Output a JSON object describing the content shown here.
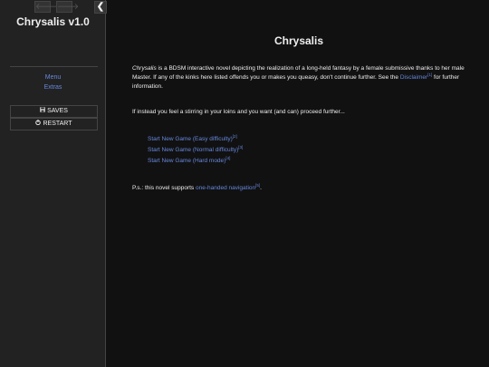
{
  "ui_bar": {
    "story_title": "Chrysalis v1.0",
    "history_back_icon": "arrow-left-icon",
    "history_forward_icon": "arrow-right-icon",
    "toggle_icon": "chevron-left-icon",
    "back_glyph": "🡐",
    "forward_glyph": "🡒",
    "toggle_glyph": "❮",
    "menu": [
      {
        "label": "Menu"
      },
      {
        "label": "Extras"
      }
    ],
    "saves_label": "SAVES",
    "restart_label": "RESTART"
  },
  "passage": {
    "title": "Chrysalis",
    "intro": {
      "italic_name": "Chrysalis",
      "text_before_link": " is a BDSM interactive novel depicting the realization of a long-held fantasy by a female submissive thanks to her male Master. If any of the kinks here listed offends you or makes you queasy, don't continue further. See the ",
      "link_label": "Disclaimer",
      "link_ref": "[1]",
      "text_after_link": " for further information."
    },
    "stirring_text": "If instead you feel a stirring in your loins and you want (and can) proceed further...",
    "start_options": [
      {
        "label": "Start New Game (Easy difficulty)",
        "ref": "[2]"
      },
      {
        "label": "Start New Game (Normal difficulty)",
        "ref": "[3]"
      },
      {
        "label": "Start New Game (Hard mode)",
        "ref": "[4]"
      }
    ],
    "ps": {
      "text_before_link": "P.s.: this novel supports ",
      "link_label": "one-handed navigation",
      "link_ref": "[5]",
      "text_after_link": "."
    }
  },
  "colors": {
    "background": "#111111",
    "sidebar": "#222222",
    "link": "#6688dd",
    "text": "#eeeeee"
  }
}
